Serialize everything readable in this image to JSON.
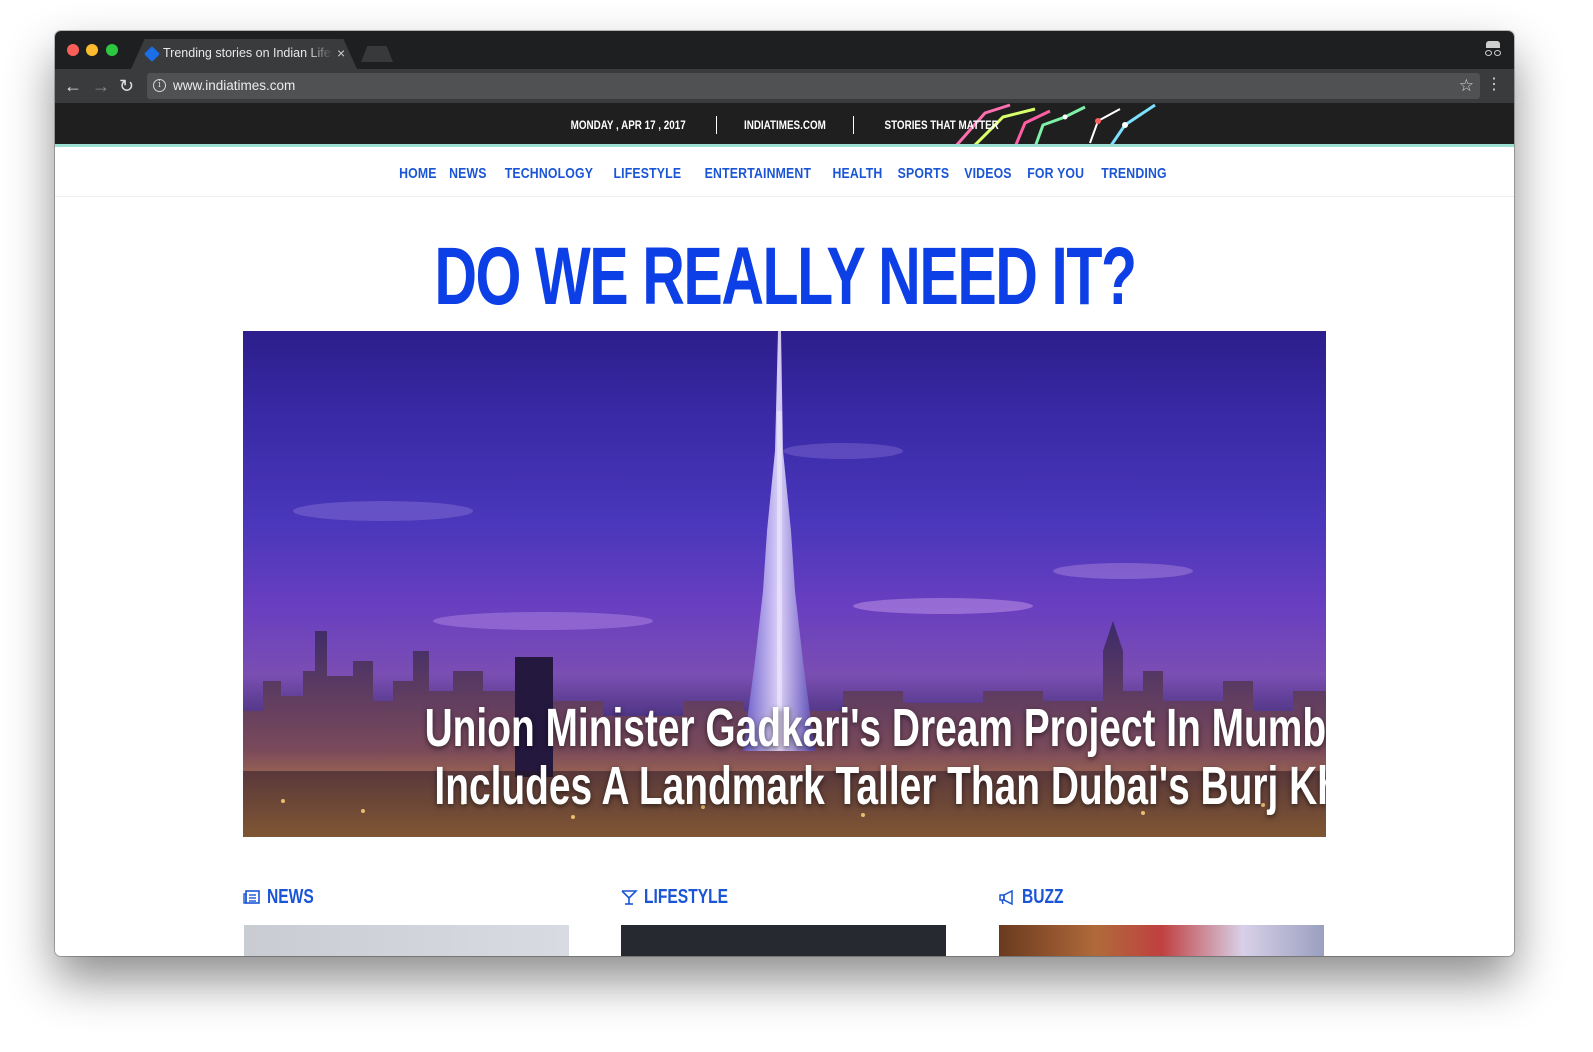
{
  "browser": {
    "tab_title": "Trending stories on Indian Lifestyle",
    "tab_close": "×",
    "url": "www.indiatimes.com",
    "info_glyph": "i",
    "back_glyph": "←",
    "forward_glyph": "→",
    "reload_glyph": "↻",
    "star_glyph": "☆",
    "menu_glyph": "⋮"
  },
  "top_strip": {
    "date": "MONDAY , APR 17 , 2017",
    "site": "INDIATIMES.COM",
    "tagline": "STORIES THAT MATTER"
  },
  "nav": {
    "items": [
      "HOME",
      "NEWS",
      "TECHNOLOGY",
      "LIFESTYLE",
      "ENTERTAINMENT",
      "HEALTH",
      "SPORTS",
      "VIDEOS",
      "FOR YOU",
      "TRENDING"
    ]
  },
  "main": {
    "headline": "DO WE REALLY NEED IT?",
    "hero_caption_line1": "Union Minister Gadkari's Dream Project In Mumbai",
    "hero_caption_line2": "Includes A Landmark Taller Than Dubai's Burj Khalifa"
  },
  "sections": [
    {
      "title": "NEWS",
      "icon": "newspaper-icon"
    },
    {
      "title": "LIFESTYLE",
      "icon": "cocktail-glass-icon"
    },
    {
      "title": "BUZZ",
      "icon": "megaphone-icon"
    }
  ],
  "colors": {
    "brand_blue": "#0d3fe6",
    "nav_blue": "#1a55d6",
    "strip_bg": "#1f1f1f",
    "strip_accent": "#9adfd2"
  }
}
